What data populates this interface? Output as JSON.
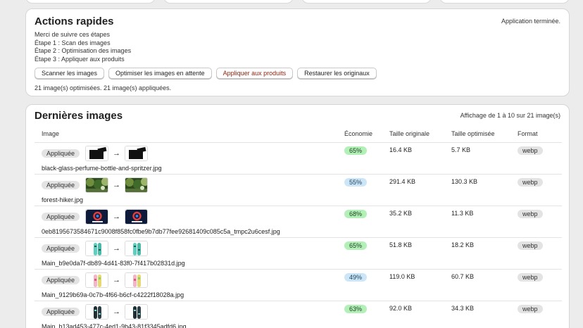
{
  "actions": {
    "title": "Actions rapides",
    "status": "Application terminée.",
    "steps": [
      "Merci de suivre ces étapes",
      "Étape 1 : Scan des images",
      "Étape 2 : Optimisation des images",
      "Étape 3 : Appliquer aux produits"
    ],
    "buttons": {
      "scan": "Scanner les images",
      "optimize": "Optimiser les images en attente",
      "apply": "Appliquer aux produits",
      "restore": "Restaurer les originaux"
    },
    "summary": "21 image(s) optimisées.   21 image(s) appliquées."
  },
  "images": {
    "title": "Dernières images",
    "range": "Affichage de 1 à 10 sur 21 image(s)",
    "headers": {
      "image": "Image",
      "economy": "Économie",
      "original": "Taille originale",
      "optimized": "Taille optimisée",
      "format": "Format"
    },
    "rows": [
      {
        "status": "Appliquée",
        "arrow": "→",
        "thumb": "perfume",
        "file": "black-glass-perfume-bottle-and-spritzer.jpg",
        "economy": "65%",
        "economy_color": "green",
        "original": "16.4 KB",
        "optimized": "5.7 KB",
        "format": "webp"
      },
      {
        "status": "Appliquée",
        "arrow": "→",
        "thumb": "forest",
        "file": "forest-hiker.jpg",
        "economy": "55%",
        "economy_color": "blue",
        "original": "291.4 KB",
        "optimized": "130.3 KB",
        "format": "webp"
      },
      {
        "status": "Appliquée",
        "arrow": "→",
        "thumb": "logo",
        "file": "0eb819567358467 1c9008f858fc0fbe9b7db77fee92681409c085c5a_tmpc2u6cesf.jpg",
        "economy": "68%",
        "economy_color": "green",
        "original": "35.2 KB",
        "optimized": "11.3 KB",
        "format": "webp"
      },
      {
        "status": "Appliquée",
        "arrow": "→",
        "thumb": "board-teal",
        "file": "Main_b9e0da7f-db89-4d41-83f0-7f417b02831d.jpg",
        "economy": "65%",
        "economy_color": "green",
        "original": "51.8 KB",
        "optimized": "18.2 KB",
        "format": "webp"
      },
      {
        "status": "Appliquée",
        "arrow": "→",
        "thumb": "board-pink",
        "file": "Main_9129b69a-0c7b-4f66-b6cf-c4222f18028a.jpg",
        "economy": "49%",
        "economy_color": "blue",
        "original": "119.0 KB",
        "optimized": "60.7 KB",
        "format": "webp"
      },
      {
        "status": "Appliquée",
        "arrow": "→",
        "thumb": "board-dark",
        "file": "Main_b13ad453-477c-4ed1-9b43-81f3345adfd6.jpg",
        "economy": "63%",
        "economy_color": "green",
        "original": "92.0 KB",
        "optimized": "34.3 KB",
        "format": "webp"
      }
    ]
  },
  "colors": {
    "economy_green": "#b3f0b7",
    "economy_blue": "#cde6f7",
    "danger_text": "#8e1f0b"
  }
}
